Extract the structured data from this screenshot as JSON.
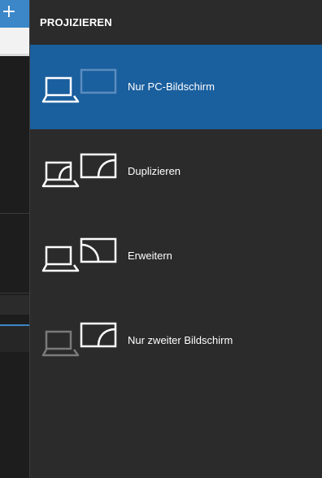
{
  "background_app": {
    "tab_add_glyph": "+"
  },
  "panel": {
    "title": "PROJIZIEREN",
    "options": [
      {
        "label": "Nur PC-Bildschirm",
        "icon": "pc-screen-only-icon",
        "selected": true
      },
      {
        "label": "Duplizieren",
        "icon": "duplicate-icon",
        "selected": false
      },
      {
        "label": "Erweitern",
        "icon": "extend-icon",
        "selected": false
      },
      {
        "label": "Nur zweiter Bildschirm",
        "icon": "second-screen-only-icon",
        "selected": false
      }
    ]
  },
  "colors": {
    "panel_bg": "#2b2b2b",
    "selected_bg": "#1a5f9e",
    "icon_white": "#ffffff",
    "icon_dim_selected": "#5b8cbf",
    "icon_dim": "#7a7a7a",
    "accent_blue": "#3b87c8"
  }
}
